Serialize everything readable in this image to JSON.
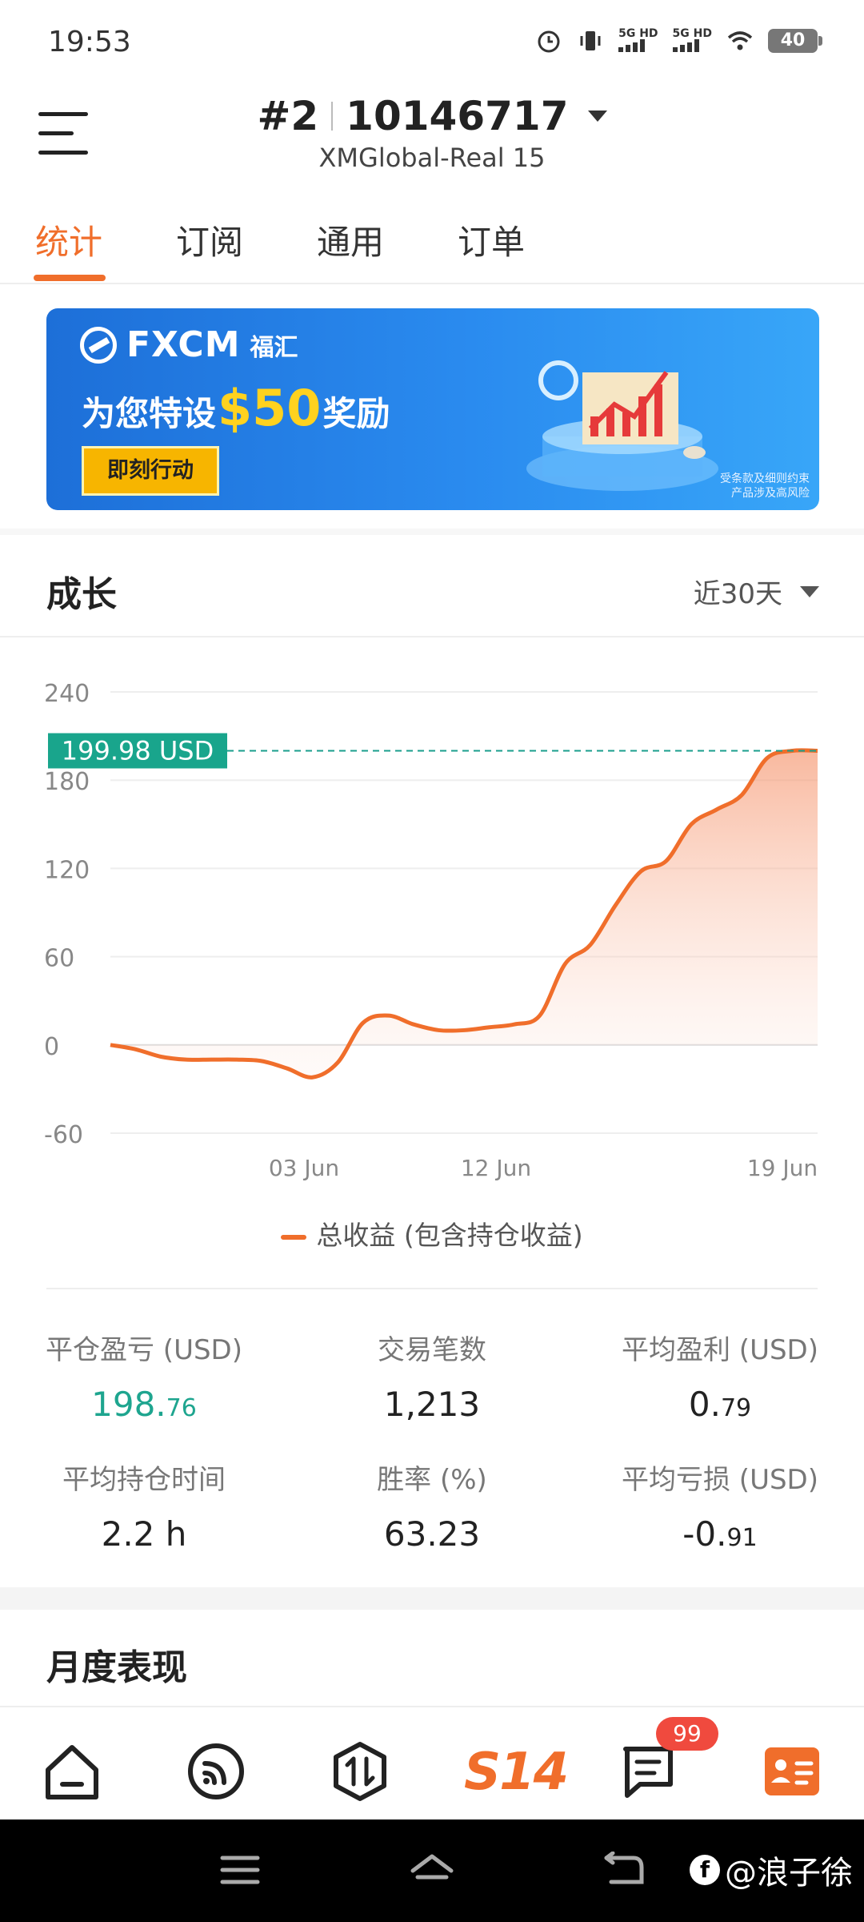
{
  "status_bar": {
    "time": "19:53",
    "network1": "5G HD",
    "network2": "5G HD",
    "battery": "40"
  },
  "header": {
    "account_index": "#2",
    "account_number": "10146717",
    "server": "XMGlobal-Real 15"
  },
  "tabs": [
    {
      "label": "统计",
      "active": true
    },
    {
      "label": "订阅",
      "active": false
    },
    {
      "label": "通用",
      "active": false
    },
    {
      "label": "订单",
      "active": false
    }
  ],
  "banner": {
    "brand": "FXCM",
    "brand_cn": "福汇",
    "headline_pre": "为您特设",
    "headline_amount": "$50",
    "headline_post": "奖励",
    "cta": "即刻行动",
    "disclaimer_line1": "受条款及细则约束",
    "disclaimer_line2": "产品涉及高风险"
  },
  "growth": {
    "title": "成长",
    "period": "近30天"
  },
  "chart_data": {
    "type": "area",
    "y_ticks": [
      "240",
      "180",
      "120",
      "60",
      "0",
      "-60"
    ],
    "ylim": [
      -60,
      240
    ],
    "x_tick_labels": [
      "03 Jun",
      "12 Jun",
      "19 Jun"
    ],
    "current_value_label": "199.98 USD",
    "current_value": 199.98,
    "series": [
      {
        "name": "总收益 (包含持仓收益)",
        "color": "#f06e2b",
        "values": [
          0,
          -3,
          -8,
          -10,
          -10,
          -10,
          -11,
          -16,
          -22,
          -12,
          15,
          20,
          14,
          10,
          10,
          12,
          14,
          20,
          55,
          68,
          95,
          118,
          125,
          150,
          160,
          170,
          195,
          199.98,
          199.98
        ]
      }
    ]
  },
  "stats": [
    {
      "label": "平仓盈亏 (USD)",
      "value_main": "198.",
      "value_small": "76",
      "color": "green"
    },
    {
      "label": "交易笔数",
      "value_main": "1,213",
      "value_small": ""
    },
    {
      "label": "平均盈利 (USD)",
      "value_main": "0.",
      "value_small": "79"
    },
    {
      "label": "平均持仓时间",
      "value_main": "2.2 h",
      "value_small": ""
    },
    {
      "label": "胜率 (%)",
      "value_main": "63.23",
      "value_small": ""
    },
    {
      "label": "平均亏损 (USD)",
      "value_main": "-0.",
      "value_small": "91"
    }
  ],
  "monthly": {
    "title": "月度表现"
  },
  "bottom_nav": {
    "items": [
      "home-icon",
      "feed-icon",
      "trade-icon",
      "s14-logo",
      "messages-icon",
      "account-card-icon"
    ],
    "logo_text": "S14",
    "badge": "99"
  },
  "watermark": {
    "text": "@浪子徐",
    "logo": "f"
  }
}
